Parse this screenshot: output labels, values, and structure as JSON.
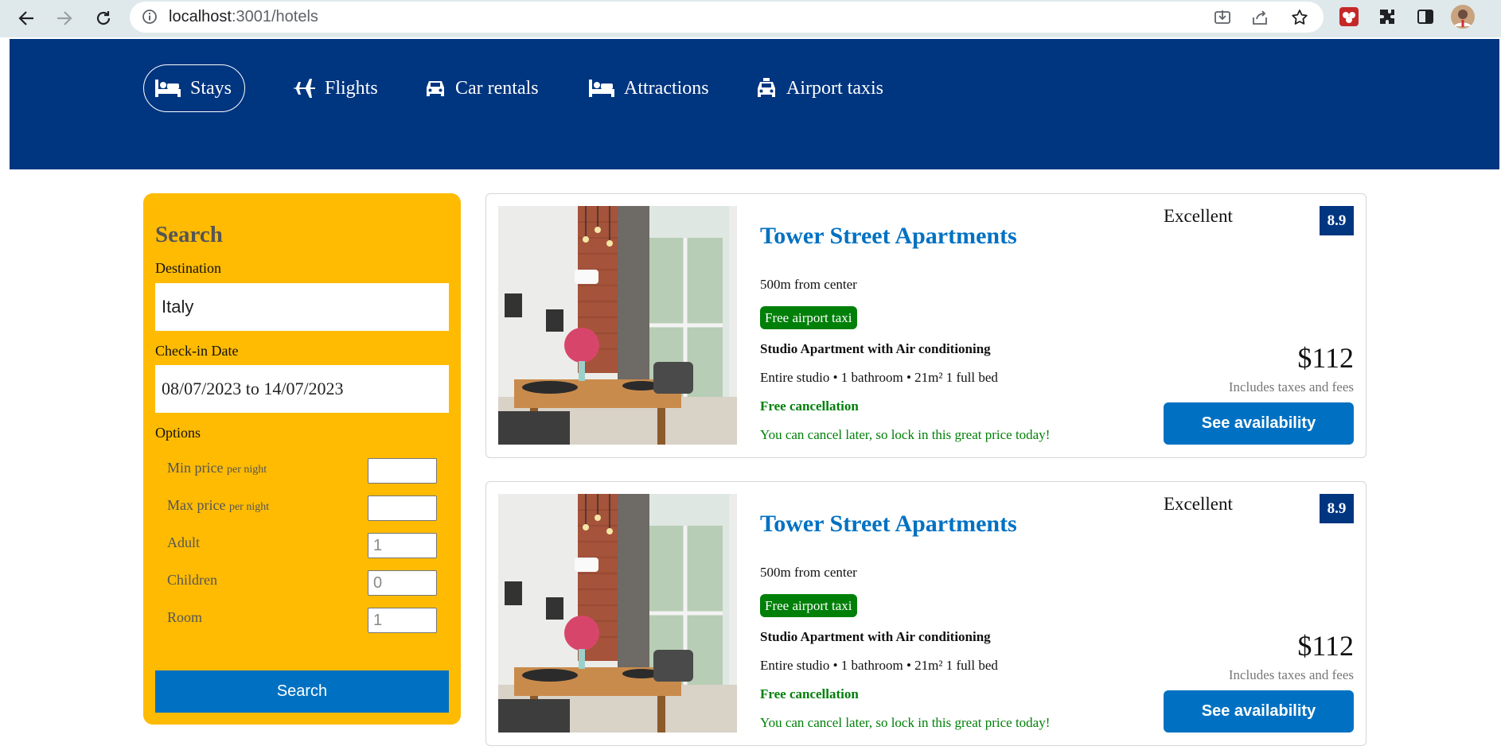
{
  "browser": {
    "url_host": "localhost",
    "url_path": ":3001/hotels"
  },
  "nav": {
    "items": [
      {
        "label": "Stays",
        "icon": "bed-icon",
        "active": true
      },
      {
        "label": "Flights",
        "icon": "plane-icon"
      },
      {
        "label": "Car rentals",
        "icon": "car-icon"
      },
      {
        "label": "Attractions",
        "icon": "bed-icon"
      },
      {
        "label": "Airport taxis",
        "icon": "taxi-icon"
      }
    ]
  },
  "search": {
    "title": "Search",
    "destination_label": "Destination",
    "destination_value": "Italy",
    "checkin_label": "Check-in Date",
    "checkin_value": "08/07/2023 to 14/07/2023",
    "options_label": "Options",
    "options": [
      {
        "label": "Min price",
        "suffix": "per night",
        "value": ""
      },
      {
        "label": "Max price",
        "suffix": "per night",
        "value": ""
      },
      {
        "label": "Adult",
        "suffix": "",
        "value": "1"
      },
      {
        "label": "Children",
        "suffix": "",
        "value": "0"
      },
      {
        "label": "Room",
        "suffix": "",
        "value": "1"
      }
    ],
    "button_label": "Search"
  },
  "results": [
    {
      "name": "Tower Street Apartments",
      "distance": "500m from center",
      "taxi_badge": "Free airport taxi",
      "room_title": "Studio Apartment with Air conditioning",
      "room_features": "Entire studio • 1 bathroom • 21m² 1 full bed",
      "cancel_title": "Free cancellation",
      "cancel_subtitle": "You can cancel later, so lock in this great price today!",
      "rating_text": "Excellent",
      "rating_score": "8.9",
      "price": "$112",
      "tax_note": "Includes taxes and fees",
      "button_label": "See availability"
    },
    {
      "name": "Tower Street Apartments",
      "distance": "500m from center",
      "taxi_badge": "Free airport taxi",
      "room_title": "Studio Apartment with Air conditioning",
      "room_features": "Entire studio • 1 bathroom • 21m² 1 full bed",
      "cancel_title": "Free cancellation",
      "cancel_subtitle": "You can cancel later, so lock in this great price today!",
      "rating_text": "Excellent",
      "rating_score": "8.9",
      "price": "$112",
      "tax_note": "Includes taxes and fees",
      "button_label": "See availability"
    }
  ],
  "colors": {
    "header_bg": "#003580",
    "search_panel_bg": "#febb02",
    "primary_button": "#0071c2",
    "badge_green": "#008009"
  }
}
